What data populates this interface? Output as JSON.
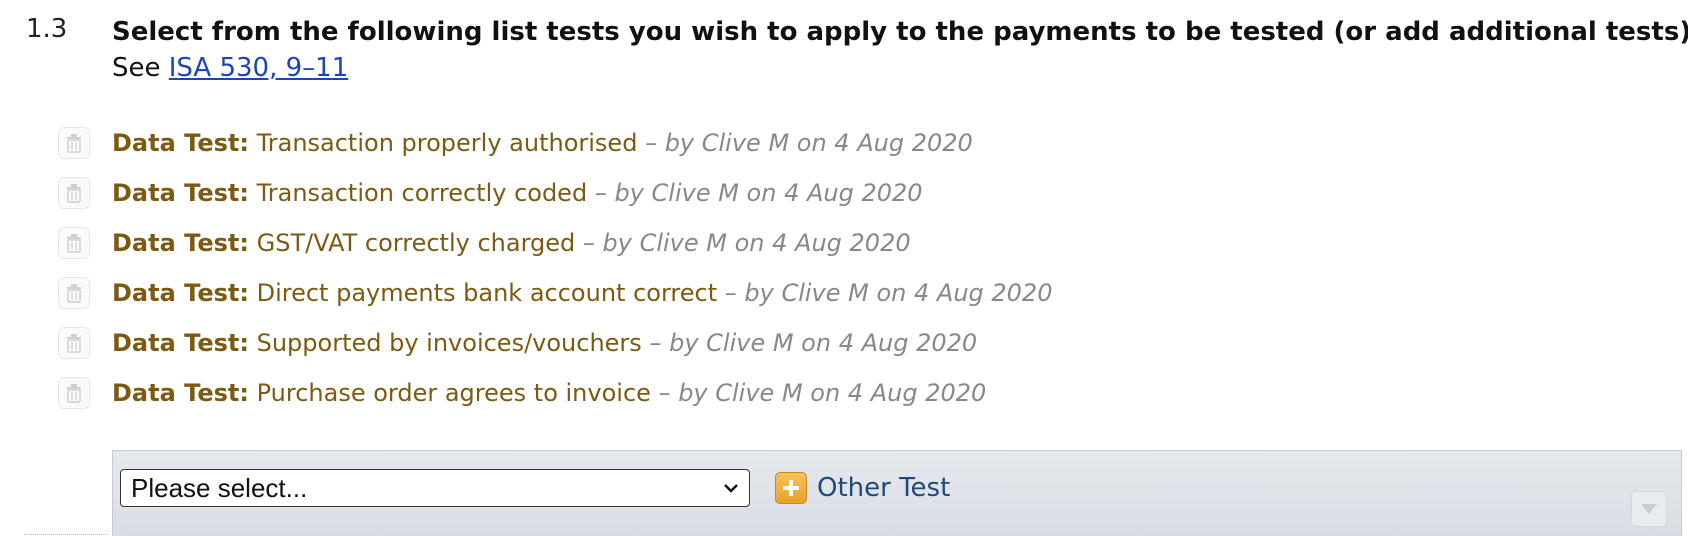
{
  "step": {
    "number": "1.3",
    "title": "Select from the following list tests you wish to apply to the payments to be tested (or add additional tests).",
    "see_prefix": "See",
    "link_text": "ISA 530, 9–11"
  },
  "tests": [
    {
      "label": "Data Test:",
      "name": "Transaction properly authorised",
      "meta": "– by Clive M on 4 Aug 2020"
    },
    {
      "label": "Data Test:",
      "name": "Transaction correctly coded",
      "meta": "– by Clive M on 4 Aug 2020"
    },
    {
      "label": "Data Test:",
      "name": "GST/VAT correctly charged",
      "meta": "– by Clive M on 4 Aug 2020"
    },
    {
      "label": "Data Test:",
      "name": "Direct payments bank account correct",
      "meta": "– by Clive M on 4 Aug 2020"
    },
    {
      "label": "Data Test:",
      "name": "Supported by invoices/vouchers",
      "meta": "– by Clive M on 4 Aug 2020"
    },
    {
      "label": "Data Test:",
      "name": "Purchase order agrees to invoice",
      "meta": "– by Clive M on 4 Aug 2020"
    }
  ],
  "toolbar": {
    "select_value": "Please select...",
    "other_test_label": "Other Test"
  },
  "icons": {
    "delete": "trash-icon",
    "add": "plus-icon",
    "dropdown": "chevron-down-icon",
    "collapse": "triangle-down-icon"
  },
  "colors": {
    "test_text": "#7d5a12",
    "meta_text": "#888888",
    "link": "#1a44b8",
    "accent_add": "#e8a12a",
    "other_test": "#1f4a7a"
  }
}
